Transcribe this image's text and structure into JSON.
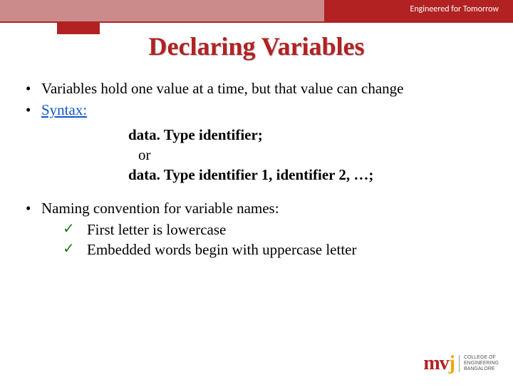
{
  "header": {
    "tagline": "Engineered for Tomorrow"
  },
  "title": "Declaring Variables",
  "bullets": {
    "b1": "Variables hold one value at a time, but that value can change",
    "b2_label": "Syntax:"
  },
  "code": {
    "line1": "data. Type identifier;",
    "or": "or",
    "line2": "data. Type identifier 1, identifier 2, …;"
  },
  "naming": {
    "heading": "Naming convention for variable names:",
    "items": {
      "i1": "First letter is lowercase",
      "i2": "Embedded words begin with uppercase letter"
    }
  },
  "footer": {
    "logo_text_prefix": "m",
    "logo_text_mid": "v",
    "logo_text_suffix": "j",
    "logo_sub1": "COLLEGE OF",
    "logo_sub2": "ENGINEERING",
    "logo_sub3": "BANGALORE"
  }
}
